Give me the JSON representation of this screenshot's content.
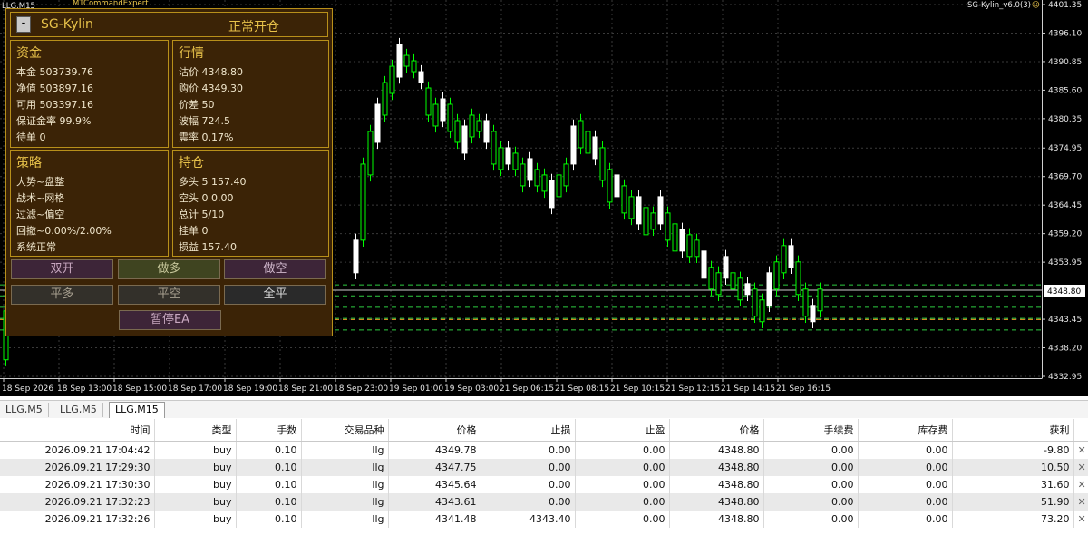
{
  "chart": {
    "symbol_label": "LLG,M15",
    "indicator_label": "MTCommandExpert",
    "ea_label": "SG-Kylin_v6.0(3)",
    "current_price_label": "4348.80",
    "colors": {
      "bull": "#00ff00",
      "bear": "#ffffff",
      "bull_fill": "#000000",
      "bear_fill": "#ffffff",
      "grid": "#3a3a3a",
      "level_green": "#2ecc40",
      "level_orange": "#f0a020"
    },
    "price_axis_labels": [
      "4401.35",
      "4396.10",
      "4390.85",
      "4385.60",
      "4380.35",
      "4374.95",
      "4369.70",
      "4364.45",
      "4359.20",
      "4353.95",
      "4343.45",
      "4338.20",
      "4332.95"
    ],
    "time_axis_labels": [
      "18 Sep 2026",
      "18 Sep 13:00",
      "18 Sep 15:00",
      "18 Sep 17:00",
      "18 Sep 19:00",
      "18 Sep 21:00",
      "18 Sep 23:00",
      "19 Sep 01:00",
      "19 Sep 03:00",
      "21 Sep 06:15",
      "21 Sep 08:15",
      "21 Sep 10:15",
      "21 Sep 12:15",
      "21 Sep 14:15",
      "21 Sep 16:15"
    ]
  },
  "ea_panel": {
    "name": "SG-Kylin",
    "status": "正常开仓",
    "min_button": "-",
    "funds": {
      "title": "资金",
      "lines": [
        "本金 503739.76",
        "净值 503897.16",
        "可用 503397.16",
        "保证金率 99.9%",
        "待单 0"
      ]
    },
    "market": {
      "title": "行情",
      "lines": [
        "沽价 4348.80",
        "购价 4349.30",
        "价差 50",
        "波幅 724.5",
        "震率 0.17%"
      ]
    },
    "strategy": {
      "title": "策略",
      "lines": [
        "大势~盘整",
        "战术~网格",
        "过滤~偏空",
        "回撤~0.00%/2.00%",
        "系统正常"
      ]
    },
    "position": {
      "title": "持仓",
      "lines": [
        "多头 5 157.40",
        "空头 0 0.00",
        "总计 5/10",
        "挂单 0",
        "损益 157.40"
      ]
    },
    "buttons": [
      "双开",
      "做多",
      "做空",
      "平多",
      "平空",
      "全平",
      "暂停EA"
    ]
  },
  "tabs": [
    "LLG,M5",
    "LLG,M5",
    "LLG,M15"
  ],
  "table": {
    "headers": [
      "时间",
      "类型",
      "手数",
      "交易品种",
      "价格",
      "止损",
      "止盈",
      "价格",
      "手续费",
      "库存费",
      "获利"
    ],
    "rows": [
      [
        "2026.09.21 17:04:42",
        "buy",
        "0.10",
        "llg",
        "4349.78",
        "0.00",
        "0.00",
        "4348.80",
        "0.00",
        "0.00",
        "-9.80"
      ],
      [
        "2026.09.21 17:29:30",
        "buy",
        "0.10",
        "llg",
        "4347.75",
        "0.00",
        "0.00",
        "4348.80",
        "0.00",
        "0.00",
        "10.50"
      ],
      [
        "2026.09.21 17:30:30",
        "buy",
        "0.10",
        "llg",
        "4345.64",
        "0.00",
        "0.00",
        "4348.80",
        "0.00",
        "0.00",
        "31.60"
      ],
      [
        "2026.09.21 17:32:23",
        "buy",
        "0.10",
        "llg",
        "4343.61",
        "0.00",
        "0.00",
        "4348.80",
        "0.00",
        "0.00",
        "51.90"
      ],
      [
        "2026.09.21 17:32:26",
        "buy",
        "0.10",
        "llg",
        "4341.48",
        "4343.40",
        "0.00",
        "4348.80",
        "0.00",
        "0.00",
        "73.20"
      ]
    ],
    "close_glyph": "✕"
  }
}
